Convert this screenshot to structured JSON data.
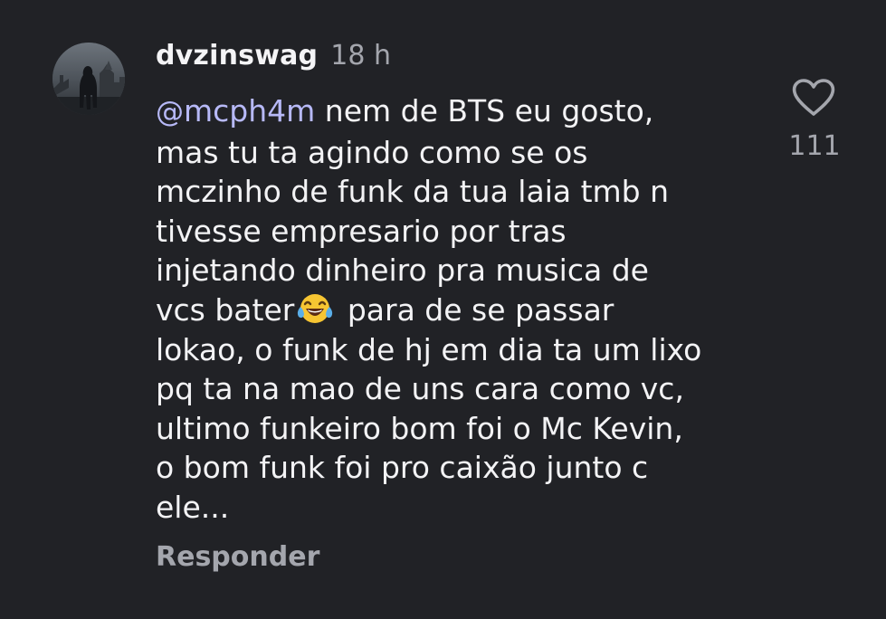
{
  "comment": {
    "username": "dvzinswag",
    "timestamp": "18 h",
    "mention_symbol": "@",
    "mention": "mcph4m",
    "lines": [
      " nem de BTS eu gosto,",
      "mas tu ta agindo como se os",
      "mczinho de funk da tua laia tmb n",
      "tivesse empresario por tras",
      "injetando dinheiro pra musica de",
      "vcs bater",
      " para de se passar",
      "lokao, o funk de hj em dia ta um lixo",
      "pq ta na mao de uns cara como vc,",
      "ultimo funkeiro bom foi o Mc Kevin,",
      "o bom funk foi pro caixão junto c",
      "ele..."
    ],
    "emoji": "face-with-tears-of-joy",
    "reply_label": "Responder",
    "like_count": "111",
    "like_icon": "heart-outline-icon"
  },
  "colors": {
    "background": "#212226",
    "text": "#f3f3f5",
    "secondary": "#a4a6ad",
    "mention": "#b7b9f7"
  }
}
